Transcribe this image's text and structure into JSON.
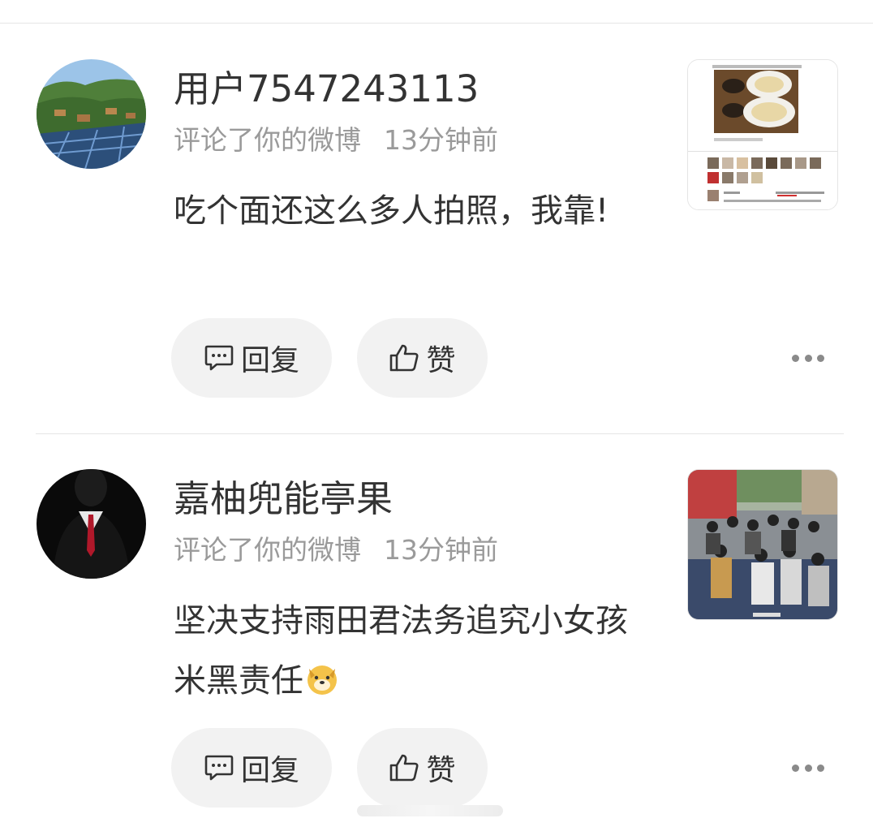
{
  "comments": [
    {
      "username": "用户7547243113",
      "action": "评论了你的微博",
      "time": "13分钟前",
      "text": "吃个面还这么多人拍照，我靠!",
      "reply_label": "回复",
      "like_label": "赞",
      "avatar_icon": "landscape-solar-avatar",
      "thumb_icon": "dumpling-screenshot-thumb"
    },
    {
      "username": "嘉柚兜能亭果",
      "action": "评论了你的微博",
      "time": "13分钟前",
      "text": "坚决支持雨田君法务追究小女孩米黑责任",
      "reply_label": "回复",
      "like_label": "赞",
      "avatar_icon": "suit-silhouette-avatar",
      "thumb_icon": "crowd-street-photo-thumb"
    }
  ],
  "colors": {
    "text": "#333333",
    "meta": "#9a9a9a",
    "button_bg": "#f2f2f2"
  }
}
